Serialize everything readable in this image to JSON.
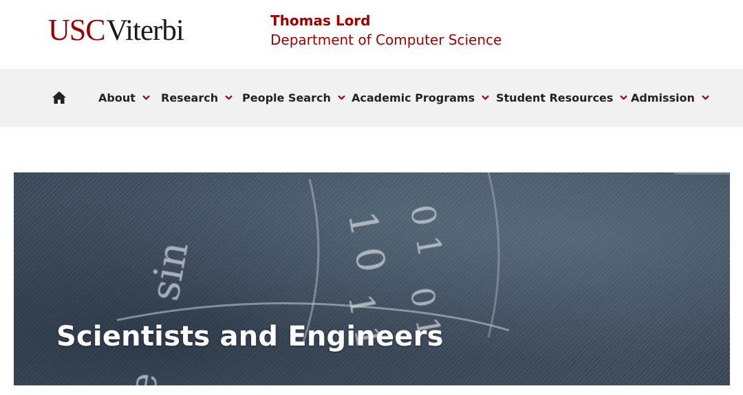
{
  "header": {
    "logo_usc": "USC",
    "logo_viterbi": "Viterbi",
    "dept_name": "Thomas Lord",
    "dept_subtitle": "Department of Computer Science"
  },
  "nav": {
    "items": [
      {
        "label": "About"
      },
      {
        "label": "Research"
      },
      {
        "label": "People Search"
      },
      {
        "label": "Academic Programs"
      },
      {
        "label": "Student Resources"
      },
      {
        "label": "Admission"
      }
    ]
  },
  "hero": {
    "title": "Scientists and Engineers"
  },
  "colors": {
    "brand": "#990000",
    "nav_bg": "#f1f1f1",
    "nav_text": "#222222"
  },
  "icons": {
    "home": "home-icon",
    "chevron": "chevron-down-icon"
  }
}
